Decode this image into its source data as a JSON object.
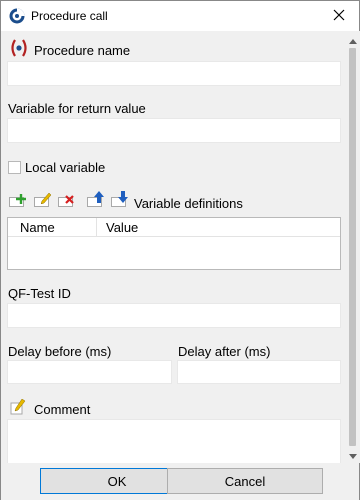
{
  "window": {
    "title": "Procedure call",
    "icons": {
      "app": "qftest-logo-icon",
      "close": "close-icon"
    }
  },
  "form": {
    "procedure_name_label": "Procedure name",
    "procedure_name_value": "",
    "return_variable_label": "Variable for return value",
    "return_variable_value": "",
    "local_variable_label": "Local variable",
    "local_variable_checked": false,
    "variable_definitions_label": "Variable definitions",
    "toolbar_icons": [
      "add-row-icon",
      "edit-row-icon",
      "delete-row-icon",
      "move-up-icon",
      "move-down-icon"
    ],
    "table_columns": [
      "Name",
      "Value"
    ],
    "table_rows": [],
    "qftest_id_label": "QF-Test ID",
    "qftest_id_value": "",
    "delay_before_label": "Delay before (ms)",
    "delay_before_value": "",
    "delay_after_label": "Delay after (ms)",
    "delay_after_value": "",
    "comment_label": "Comment",
    "comment_value": ""
  },
  "buttons": {
    "ok": "OK",
    "cancel": "Cancel"
  },
  "colors": {
    "accent": "#0078d7",
    "procedure_icon": "#b22222",
    "add": "#2ea02e",
    "delete": "#d62020",
    "edit": "#e6b800",
    "arrow": "#1f5fbf"
  }
}
